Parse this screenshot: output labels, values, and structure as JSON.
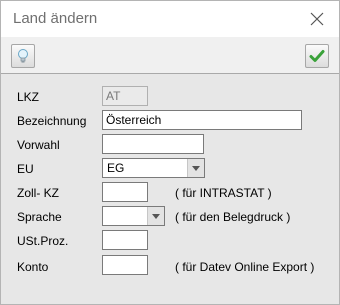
{
  "window": {
    "title": "Land ändern"
  },
  "toolbar": {
    "left_icon": "lightbulb-icon",
    "right_icon": "checkmark-icon"
  },
  "form": {
    "lkz": {
      "label": "LKZ",
      "value": "AT"
    },
    "bezeichnung": {
      "label": "Bezeichnung",
      "value": "Österreich"
    },
    "vorwahl": {
      "label": "Vorwahl",
      "value": ""
    },
    "eu": {
      "label": "EU",
      "value": "EG"
    },
    "zoll_kz": {
      "label": "Zoll- KZ",
      "value": "",
      "hint": "( für INTRASTAT )"
    },
    "sprache": {
      "label": "Sprache",
      "value": "",
      "hint": "( für den Belegdruck )"
    },
    "ust_proz": {
      "label": "USt.Proz.",
      "value": ""
    },
    "konto": {
      "label": "Konto",
      "value": "",
      "hint": "( für Datev Online Export )"
    }
  },
  "colors": {
    "title_text": "#707070",
    "form_background": "#e7e7e7",
    "checkmark_green": "#3aa23a"
  }
}
